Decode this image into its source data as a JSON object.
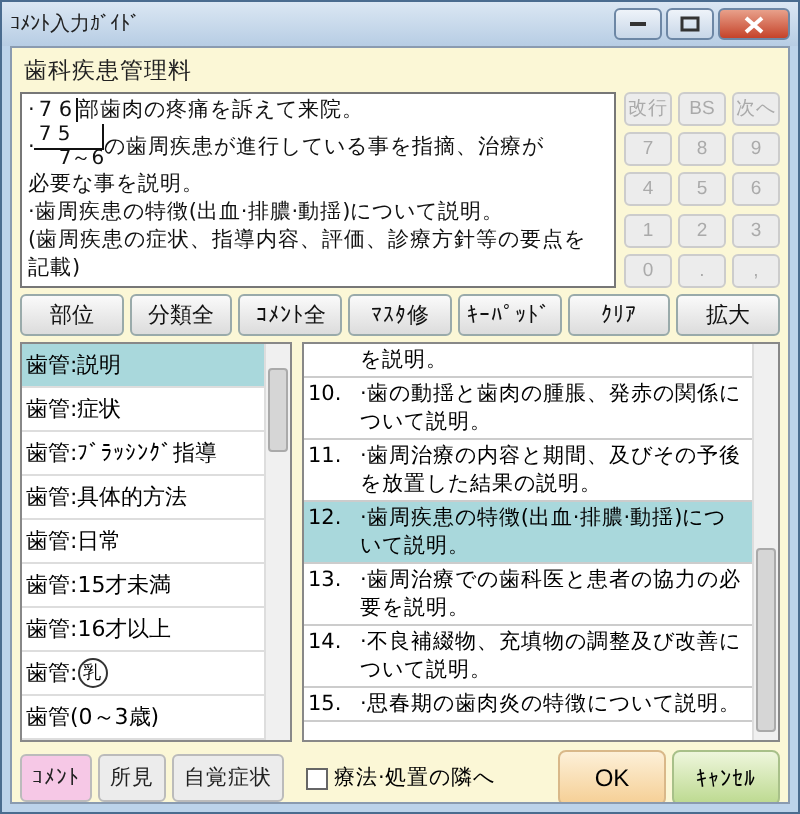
{
  "window": {
    "title": "ｺﾒﾝﾄ入力ｶﾞｲﾄﾞ"
  },
  "header": "歯科疾患管理料",
  "editor": {
    "lines": [
      {
        "kind": "tooth",
        "bullet": "·",
        "upper": "7 6",
        "text": "部歯肉の疼痛を訴えて来院。"
      },
      {
        "kind": "tooth_pair",
        "bullet": "·",
        "upper": "7 5",
        "lower": "7～6",
        "text": "の歯周疾患が進行している事を指摘、治療が"
      },
      {
        "kind": "plain",
        "text": "必要な事を説明。"
      },
      {
        "kind": "plain",
        "text": "·歯周疾患の特徴(出血·排膿·動揺)について説明。"
      },
      {
        "kind": "plain",
        "text": "(歯周疾患の症状、指導内容、評価、診療方針等の要点を記載)"
      }
    ]
  },
  "keypad": {
    "disabled": true,
    "keys": [
      "改行",
      "BS",
      "次へ",
      "7",
      "8",
      "9",
      "4",
      "5",
      "6",
      "1",
      "2",
      "3",
      "0",
      ".",
      ","
    ]
  },
  "toolbar": [
    "部位",
    "分類全",
    "ｺﾒﾝﾄ全",
    "ﾏｽﾀ修",
    "ｷｰﾊﾟｯﾄﾞ",
    "ｸﾘｱ",
    "拡大"
  ],
  "categories": [
    {
      "label": "歯管:説明",
      "selected": true
    },
    {
      "label": "歯管:症状",
      "selected": false
    },
    {
      "label": "歯管:ﾌﾞﾗｯｼﾝｸﾞ指導",
      "selected": false
    },
    {
      "label": "歯管:具体的方法",
      "selected": false
    },
    {
      "label": "歯管:日常",
      "selected": false
    },
    {
      "label": "歯管:15才未満",
      "selected": false
    },
    {
      "label": "歯管:16才以上",
      "selected": false
    },
    {
      "label": "歯管:",
      "circled": "乳",
      "selected": false
    },
    {
      "label": "歯管(0～3歳)",
      "selected": false
    }
  ],
  "comments": [
    {
      "text": "を説明。",
      "selected": false
    },
    {
      "number": "10.",
      "text": "·歯の動揺と歯肉の腫脹、発赤の関係について説明。",
      "selected": false
    },
    {
      "number": "11.",
      "text": "·歯周治療の内容と期間、及びその予後を放置した結果の説明。",
      "selected": false
    },
    {
      "number": "12.",
      "text": "·歯周疾患の特徴(出血·排膿·動揺)について説明。",
      "selected": true
    },
    {
      "number": "13.",
      "text": "·歯周治療での歯科医と患者の協力の必要を説明。",
      "selected": false
    },
    {
      "number": "14.",
      "text": "·不良補綴物、充填物の調整及び改善について説明。",
      "selected": false
    },
    {
      "number": "15.",
      "text": "·思春期の歯肉炎の特徴について説明。",
      "selected": false
    }
  ],
  "mode_tabs": [
    {
      "label": "ｺﾒﾝﾄ",
      "selected": true
    },
    {
      "label": "所見",
      "selected": false
    },
    {
      "label": "自覚症状",
      "selected": false
    }
  ],
  "next_to_treatment": {
    "label": "療法·処置の隣へ",
    "checked": false
  },
  "ok": "OK",
  "cancel": "ｷｬﾝｾﾙ"
}
